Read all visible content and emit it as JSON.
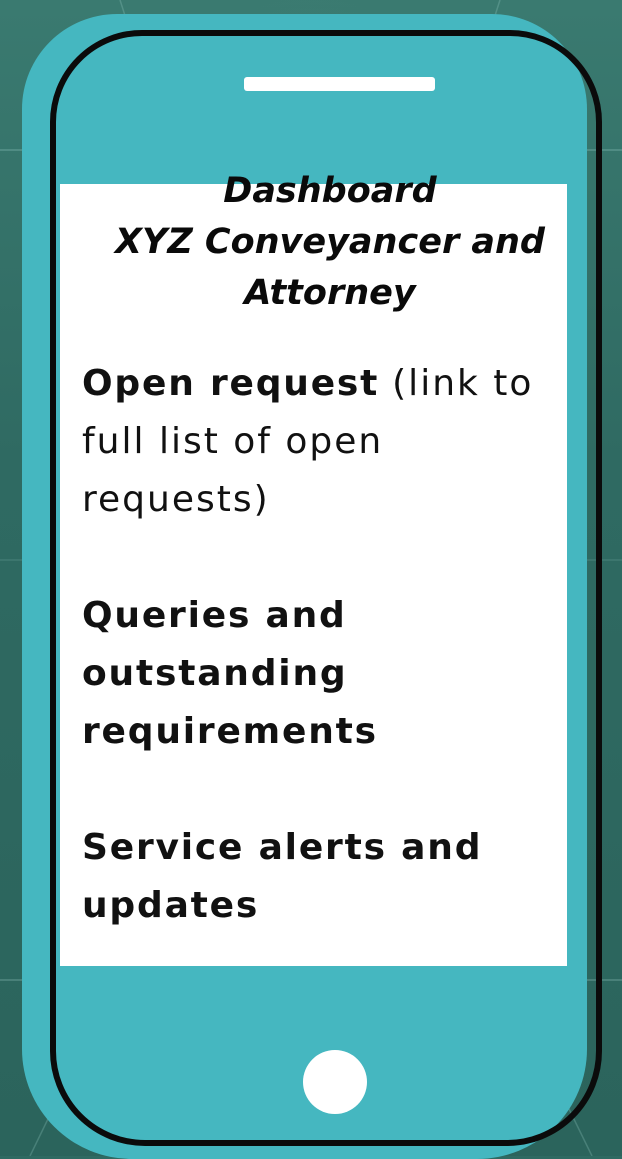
{
  "header": {
    "line1": "Dashboard",
    "line2": "XYZ Conveyancer and",
    "line3": "Attorney"
  },
  "sections": [
    {
      "title": "Open request",
      "note": "(link to full list of open requests)"
    },
    {
      "title": "Queries and outstanding requirements"
    },
    {
      "title": "Service alerts and updates"
    }
  ],
  "colors": {
    "background": "#2f6a62",
    "phone_body": "#45b7c0",
    "phone_outline": "#0b0b0b",
    "screen": "#ffffff"
  },
  "icons": {
    "speaker": "speaker-icon",
    "home_button": "home-button-icon"
  }
}
